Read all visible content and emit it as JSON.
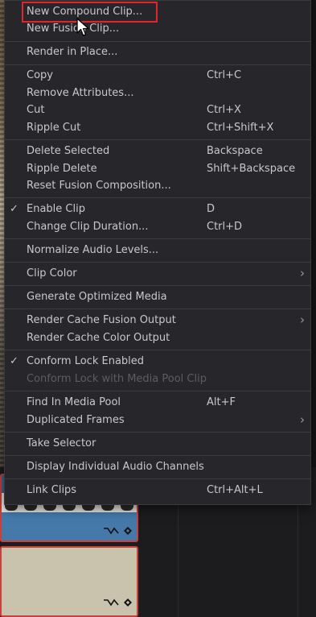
{
  "menu": {
    "items": [
      {
        "label": "New Compound Clip...",
        "shortcut": "",
        "checked": false,
        "submenu": false,
        "disabled": false
      },
      {
        "label": "New Fusion Clip...",
        "shortcut": "",
        "checked": false,
        "submenu": false,
        "disabled": false
      },
      {
        "label": "Render in Place...",
        "shortcut": "",
        "checked": false,
        "submenu": false,
        "disabled": false
      },
      {
        "label": "Copy",
        "shortcut": "Ctrl+C",
        "checked": false,
        "submenu": false,
        "disabled": false
      },
      {
        "label": "Remove Attributes...",
        "shortcut": "",
        "checked": false,
        "submenu": false,
        "disabled": false
      },
      {
        "label": "Cut",
        "shortcut": "Ctrl+X",
        "checked": false,
        "submenu": false,
        "disabled": false
      },
      {
        "label": "Ripple Cut",
        "shortcut": "Ctrl+Shift+X",
        "checked": false,
        "submenu": false,
        "disabled": false
      },
      {
        "label": "Delete Selected",
        "shortcut": "Backspace",
        "checked": false,
        "submenu": false,
        "disabled": false
      },
      {
        "label": "Ripple Delete",
        "shortcut": "Shift+Backspace",
        "checked": false,
        "submenu": false,
        "disabled": false
      },
      {
        "label": "Reset Fusion Composition...",
        "shortcut": "",
        "checked": false,
        "submenu": false,
        "disabled": false
      },
      {
        "label": "Enable Clip",
        "shortcut": "D",
        "checked": true,
        "submenu": false,
        "disabled": false
      },
      {
        "label": "Change Clip Duration...",
        "shortcut": "Ctrl+D",
        "checked": false,
        "submenu": false,
        "disabled": false
      },
      {
        "label": "Normalize Audio Levels...",
        "shortcut": "",
        "checked": false,
        "submenu": false,
        "disabled": false
      },
      {
        "label": "Clip Color",
        "shortcut": "",
        "checked": false,
        "submenu": true,
        "disabled": false
      },
      {
        "label": "Generate Optimized Media",
        "shortcut": "",
        "checked": false,
        "submenu": false,
        "disabled": false
      },
      {
        "label": "Render Cache Fusion Output",
        "shortcut": "",
        "checked": false,
        "submenu": true,
        "disabled": false
      },
      {
        "label": "Render Cache Color Output",
        "shortcut": "",
        "checked": false,
        "submenu": false,
        "disabled": false
      },
      {
        "label": "Conform Lock Enabled",
        "shortcut": "",
        "checked": true,
        "submenu": false,
        "disabled": false
      },
      {
        "label": "Conform Lock with Media Pool Clip",
        "shortcut": "",
        "checked": false,
        "submenu": false,
        "disabled": true
      },
      {
        "label": "Find In Media Pool",
        "shortcut": "Alt+F",
        "checked": false,
        "submenu": false,
        "disabled": false
      },
      {
        "label": "Duplicated Frames",
        "shortcut": "",
        "checked": false,
        "submenu": true,
        "disabled": false
      },
      {
        "label": "Take Selector",
        "shortcut": "",
        "checked": false,
        "submenu": false,
        "disabled": false
      },
      {
        "label": "Display Individual Audio Channels",
        "shortcut": "",
        "checked": false,
        "submenu": false,
        "disabled": false
      },
      {
        "label": "Link Clips",
        "shortcut": "Ctrl+Alt+L",
        "checked": false,
        "submenu": false,
        "disabled": false
      }
    ],
    "check_glyph": "✓",
    "submenu_glyph": "›"
  },
  "highlighted_item": "New Compound Clip...",
  "colors": {
    "menu_bg": "#27272b",
    "text": "#c8c8cc",
    "disabled_text": "#5c5c61",
    "highlight_box": "#e0262a",
    "clip_border": "#c8413a",
    "video_clip": "#4479aa",
    "audio_clip": "#c9c2ac"
  },
  "timeline": {
    "video_clip_icons": [
      "keyframe-curve-icon",
      "keyframe-diamond-icon"
    ],
    "audio_clip_icons": [
      "keyframe-curve-icon",
      "keyframe-diamond-icon"
    ]
  }
}
